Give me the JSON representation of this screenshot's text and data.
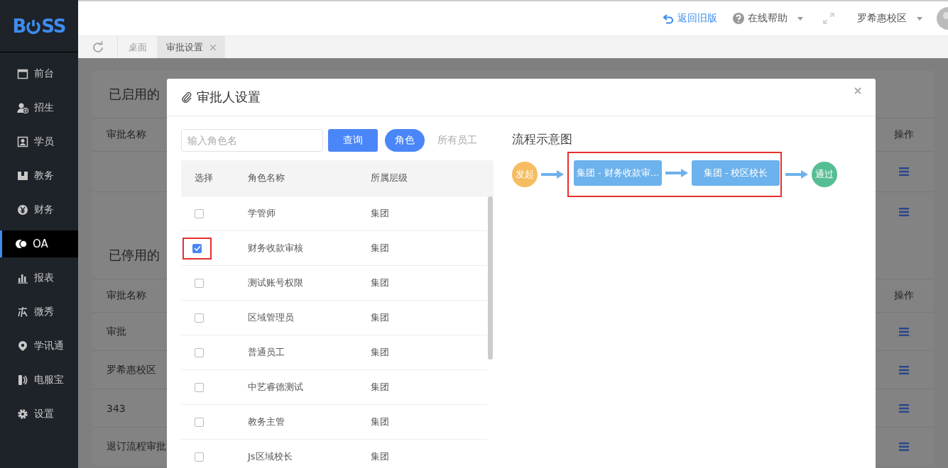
{
  "logo": {
    "before_icon": "B",
    "after_icon": "SS"
  },
  "sidebar": {
    "items": [
      {
        "label": "前台",
        "selected": false
      },
      {
        "label": "招生",
        "selected": false
      },
      {
        "label": "学员",
        "selected": false
      },
      {
        "label": "教务",
        "selected": false
      },
      {
        "label": "财务",
        "selected": false
      },
      {
        "label": "OA",
        "selected": true
      },
      {
        "label": "报表",
        "selected": false
      },
      {
        "label": "微秀",
        "selected": false
      },
      {
        "label": "学讯通",
        "selected": false
      },
      {
        "label": "电服宝",
        "selected": false
      },
      {
        "label": "设置",
        "selected": false
      }
    ]
  },
  "header": {
    "back_link": "返回旧版",
    "help": "在线帮助",
    "campus": "罗希惠校区"
  },
  "tabs": [
    {
      "label": "桌面",
      "selected": false,
      "closable": false
    },
    {
      "label": "审批设置",
      "selected": true,
      "closable": true
    }
  ],
  "background_page": {
    "sections": [
      {
        "title": "已启用的",
        "column_name": "审批名称",
        "column_actions": "操作",
        "rows": [
          "",
          ""
        ]
      },
      {
        "title": "已停用的",
        "column_name": "审批名称",
        "column_actions": "操作",
        "rows": [
          "审批",
          "罗希惠校区",
          "343",
          "退订流程审批"
        ]
      }
    ]
  },
  "dialog": {
    "title": "审批人设置",
    "search": {
      "placeholder": "输入角色名"
    },
    "query_button": "查询",
    "filters": [
      {
        "label": "角色",
        "selected": true
      },
      {
        "label": "所有员工",
        "selected": false
      }
    ],
    "table": {
      "columns": [
        "选择",
        "角色名称",
        "所属层级"
      ],
      "rows": [
        {
          "name": "学管师",
          "level": "集团",
          "checked": false,
          "highlighted": false
        },
        {
          "name": "财务收款审核",
          "level": "集团",
          "checked": true,
          "highlighted": true
        },
        {
          "name": "测试账号权限",
          "level": "集团",
          "checked": false,
          "highlighted": false
        },
        {
          "name": "区域管理员",
          "level": "集团",
          "checked": false,
          "highlighted": false
        },
        {
          "name": "普通员工",
          "level": "集团",
          "checked": false,
          "highlighted": false
        },
        {
          "name": "中艺睿德测试",
          "level": "集团",
          "checked": false,
          "highlighted": false
        },
        {
          "name": "教务主管",
          "level": "集团",
          "checked": false,
          "highlighted": false
        },
        {
          "name": "Js区域校长",
          "level": "集团",
          "checked": false,
          "highlighted": false
        }
      ]
    },
    "flow": {
      "title": "流程示意图",
      "start": "发起",
      "highlighted_steps": [
        "集团 - 财务收款审...",
        "集团 - 校区校长"
      ],
      "end": "通过"
    }
  }
}
